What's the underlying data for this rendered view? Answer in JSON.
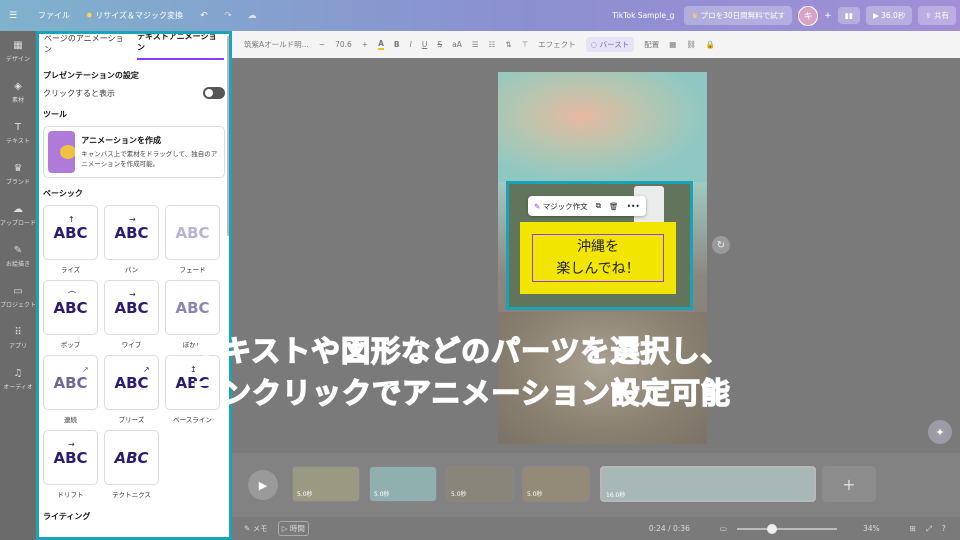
{
  "topbar": {
    "menu_icon": "menu-icon",
    "file": "ファイル",
    "resize": "リサイズ＆マジック変換",
    "doc_name": "TikTok Sample_g",
    "trial": "プロを30日間無料で試す",
    "avatar": "キ",
    "duration": "36.0秒",
    "share": "共有"
  },
  "rail": [
    {
      "icon": "design-icon",
      "label": "デザイン",
      "glyph": "▦"
    },
    {
      "icon": "elements-icon",
      "label": "素材",
      "glyph": "◈"
    },
    {
      "icon": "text-icon",
      "label": "テキスト",
      "glyph": "T"
    },
    {
      "icon": "brand-icon",
      "label": "ブランド",
      "glyph": "♛"
    },
    {
      "icon": "upload-icon",
      "label": "アップロード",
      "glyph": "☁"
    },
    {
      "icon": "draw-icon",
      "label": "お絵描き",
      "glyph": "✎"
    },
    {
      "icon": "project-icon",
      "label": "プロジェクト",
      "glyph": "▭"
    },
    {
      "icon": "apps-icon",
      "label": "アプリ",
      "glyph": "⠿"
    },
    {
      "icon": "audio-icon",
      "label": "オーディオ",
      "glyph": "♫"
    }
  ],
  "panel": {
    "tab_page": "ページのアニメーション",
    "tab_text": "テキストアニメーション",
    "presentation_heading": "プレゼンテーションの設定",
    "click_to_show": "クリックすると表示",
    "tools_heading": "ツール",
    "create_title": "アニメーションを作成",
    "create_desc": "キャンバス上で素材をドラッグして、独自のアニメーションを作成可能。",
    "basic_heading": "ベーシック",
    "writing_heading": "ライティング",
    "sample": "ABC",
    "animations": [
      "ライズ",
      "パン",
      "フェード",
      "ポップ",
      "ワイプ",
      "ぼかし",
      "連続",
      "ブリーズ",
      "ベースライン",
      "ドリフト",
      "テクトニクス"
    ]
  },
  "toolbar": {
    "font": "筑紫Aオールド明...",
    "minus": "−",
    "size": "70.6",
    "plus": "+",
    "effect": "エフェクト",
    "burst": "バースト",
    "position": "配置"
  },
  "canvas": {
    "magic_write": "マジック作文",
    "line1": "沖縄を",
    "line2": "楽しんでね！"
  },
  "timeline": {
    "clips": [
      "5.0秒",
      "5.0秒",
      "5.0秒",
      "5.0秒",
      "16.0秒"
    ],
    "add": "+"
  },
  "bottom": {
    "memo": "メモ",
    "time": "時間",
    "position": "0:24 / 0:36",
    "zoom": "34%"
  },
  "overlay": {
    "line1": "テキストや図形などのパーツを選択し、",
    "line2": "ワンクリックでアニメーション設定可能"
  }
}
